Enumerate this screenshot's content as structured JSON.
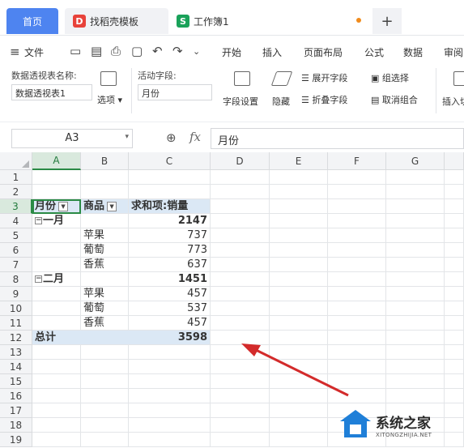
{
  "titlebar": {
    "tabs": [
      {
        "label": "首页"
      },
      {
        "label": "找稻壳模板"
      },
      {
        "label": "工作簿1"
      }
    ],
    "new_tab": "+"
  },
  "menu": {
    "items": [
      "文件",
      "开始",
      "插入",
      "页面布局",
      "公式",
      "数据",
      "审阅"
    ]
  },
  "ribbon": {
    "pivot_name_label": "数据透视表名称:",
    "pivot_name_value": "数据透视表1",
    "options": "选项",
    "active_field_label": "活动字段:",
    "active_field_value": "月份",
    "field_settings": "字段设置",
    "hide": "隐藏",
    "expand_field": "展开字段",
    "collapse_field": "折叠字段",
    "group_select": "组选择",
    "ungroup": "取消组合",
    "insert_slicer": "插入切"
  },
  "formula_bar": {
    "name_box": "A3",
    "fx": "fx",
    "value": "月份"
  },
  "sheet": {
    "columns": [
      "A",
      "B",
      "C",
      "D",
      "E",
      "F",
      "G"
    ],
    "rows": [
      "1",
      "2",
      "3",
      "4",
      "5",
      "6",
      "7",
      "8",
      "9",
      "10",
      "11",
      "12",
      "13",
      "14",
      "15",
      "16",
      "17",
      "18",
      "19"
    ],
    "pivot_headers": {
      "month": "月份",
      "product": "商品",
      "sum_label": "求和项:销量"
    },
    "groups": [
      {
        "name": "一月",
        "subtotal": "2147",
        "items": [
          {
            "product": "苹果",
            "value": "737"
          },
          {
            "product": "葡萄",
            "value": "773"
          },
          {
            "product": "香蕉",
            "value": "637"
          }
        ]
      },
      {
        "name": "二月",
        "subtotal": "1451",
        "items": [
          {
            "product": "苹果",
            "value": "457"
          },
          {
            "product": "葡萄",
            "value": "537"
          },
          {
            "product": "香蕉",
            "value": "457"
          }
        ]
      }
    ],
    "total_label": "总计",
    "total_value": "3598"
  },
  "watermark": {
    "title": "系统之家",
    "subtitle": "XITONGZHIJIA.NET"
  },
  "colors": {
    "accent": "#4e84f0",
    "annotation_arrow": "#d32b2b",
    "pivot_fill": "#dbe8f5"
  }
}
